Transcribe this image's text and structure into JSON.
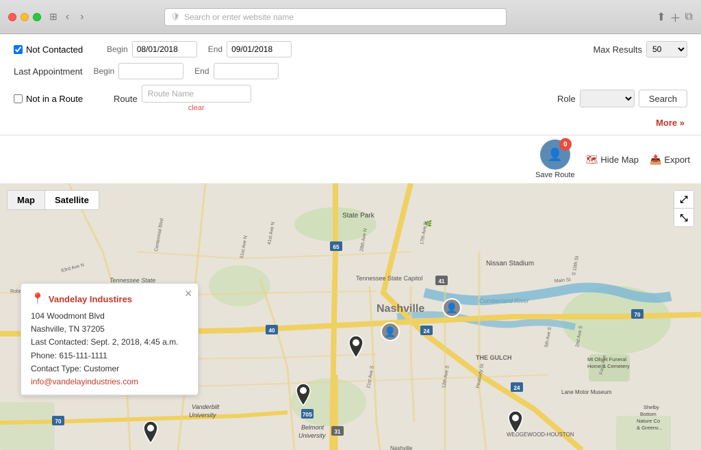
{
  "browser": {
    "address_placeholder": "Search or enter website name"
  },
  "filter": {
    "not_contacted_label": "Not Contacted",
    "not_contacted_checked": true,
    "begin_label": "Begin",
    "begin_date": "08/01/2018",
    "end_label": "End",
    "end_date": "09/01/2018",
    "max_results_label": "Max Results",
    "max_results_value": "50",
    "last_appointment_label": "Last Appointment",
    "route_label": "Route",
    "route_placeholder": "Route Name",
    "clear_label": "clear",
    "not_in_route_label": "Not in a Route",
    "role_label": "Role",
    "search_label": "Search",
    "more_label": "More »"
  },
  "map_toolbar": {
    "save_route_label": "Save Route",
    "badge_count": "0",
    "hide_map_label": "Hide Map",
    "export_label": "Export"
  },
  "map": {
    "type_map": "Map",
    "type_satellite": "Satellite",
    "popup": {
      "name": "Vandelay Industires",
      "address_line1": "104 Woodmont Blvd",
      "address_line2": "Nashville, TN 37205",
      "last_contacted": "Last Contacted: Sept. 2, 2018, 4:45 a.m.",
      "phone": "Phone: 615-111-1111",
      "contact_type": "Contact Type: Customer",
      "email": "info@vandelayindustries.com"
    },
    "labels": {
      "nashville": "Nashville",
      "tennessee_state_university": "Tennessee State University",
      "state_park": "State Park",
      "tennessee_state_capitol": "Tennessee State Capitol",
      "nissan_stadium": "Nissan Stadium",
      "vanderbilt_university": "Vanderbilt University",
      "the_gulch": "THE GULCH",
      "wedgewood": "WEDGEWOOD-HOUSTON",
      "lane_motor_museum": "Lane Motor Museum",
      "mt_olivet": "Mt Olivet Funeral Home & Cemetery",
      "cumberland_river": "Cumberland River",
      "belmont_university": "Belmont University",
      "shelby_bottom": "Shelby Bottom Nature Co & Greenv..."
    }
  }
}
